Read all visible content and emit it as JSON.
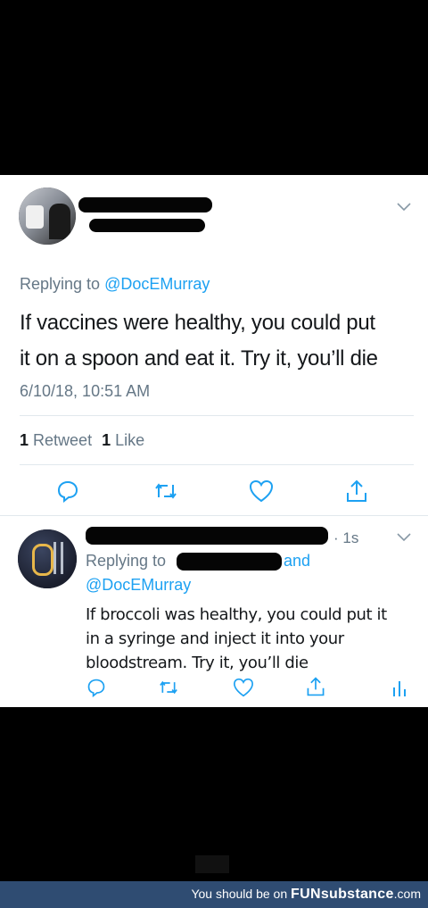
{
  "tweet": {
    "replying_to_prefix": "Replying to",
    "replying_to_handle": "@DocEMurray",
    "text_line1": "If vaccines were healthy, you could put",
    "text_line2": "it on a spoon and eat it. Try it, you’ll die",
    "timestamp": "6/10/18, 10:51 AM",
    "retweet_count": "1",
    "retweet_label": "Retweet",
    "like_count": "1",
    "like_label": "Like"
  },
  "reply": {
    "time": "· 1s",
    "replying_to_prefix": "Replying to",
    "and_word": "and",
    "handle": "@DocEMurray",
    "text_line1": "If broccoli was healthy, you could put it",
    "text_line2": "in a syringe and inject it into your",
    "text_line3": "bloodstream. Try it, you’ll die"
  },
  "footer": {
    "prefix": "You should be on",
    "brand": "FUNsubstance",
    "suffix": ".com"
  },
  "icons": [
    "chevron-down-icon",
    "reply-icon",
    "retweet-icon",
    "like-icon",
    "share-icon",
    "analytics-icon"
  ],
  "colors": {
    "link": "#1da1f2",
    "muted": "#657786",
    "icon": "#1da1f2",
    "footer": "#2f4c72"
  }
}
